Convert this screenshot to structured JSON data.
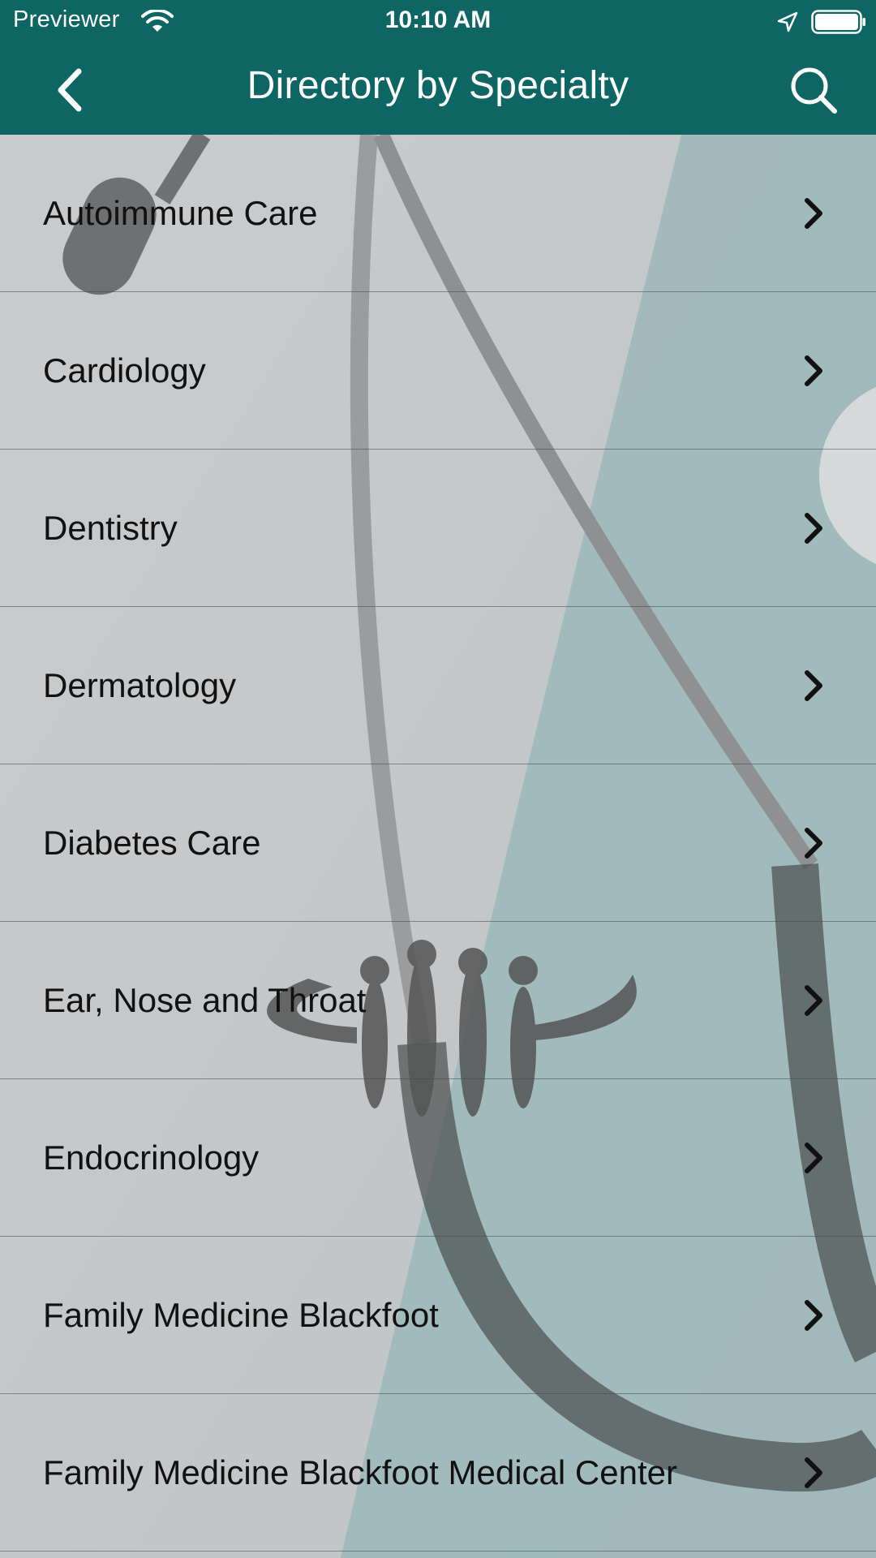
{
  "status_bar": {
    "carrier": "Previewer",
    "time": "10:10 AM"
  },
  "nav": {
    "title": "Directory by Specialty",
    "back_icon": "chevron-left-icon",
    "search_icon": "search-icon"
  },
  "colors": {
    "header": "#0d6664",
    "text": "#111111"
  },
  "specialties": [
    {
      "label": "Autoimmune Care"
    },
    {
      "label": "Cardiology"
    },
    {
      "label": "Dentistry"
    },
    {
      "label": "Dermatology"
    },
    {
      "label": "Diabetes Care"
    },
    {
      "label": "Ear, Nose and Throat"
    },
    {
      "label": "Endocrinology"
    },
    {
      "label": "Family Medicine Blackfoot"
    },
    {
      "label": "Family Medicine Blackfoot Medical Center"
    }
  ]
}
